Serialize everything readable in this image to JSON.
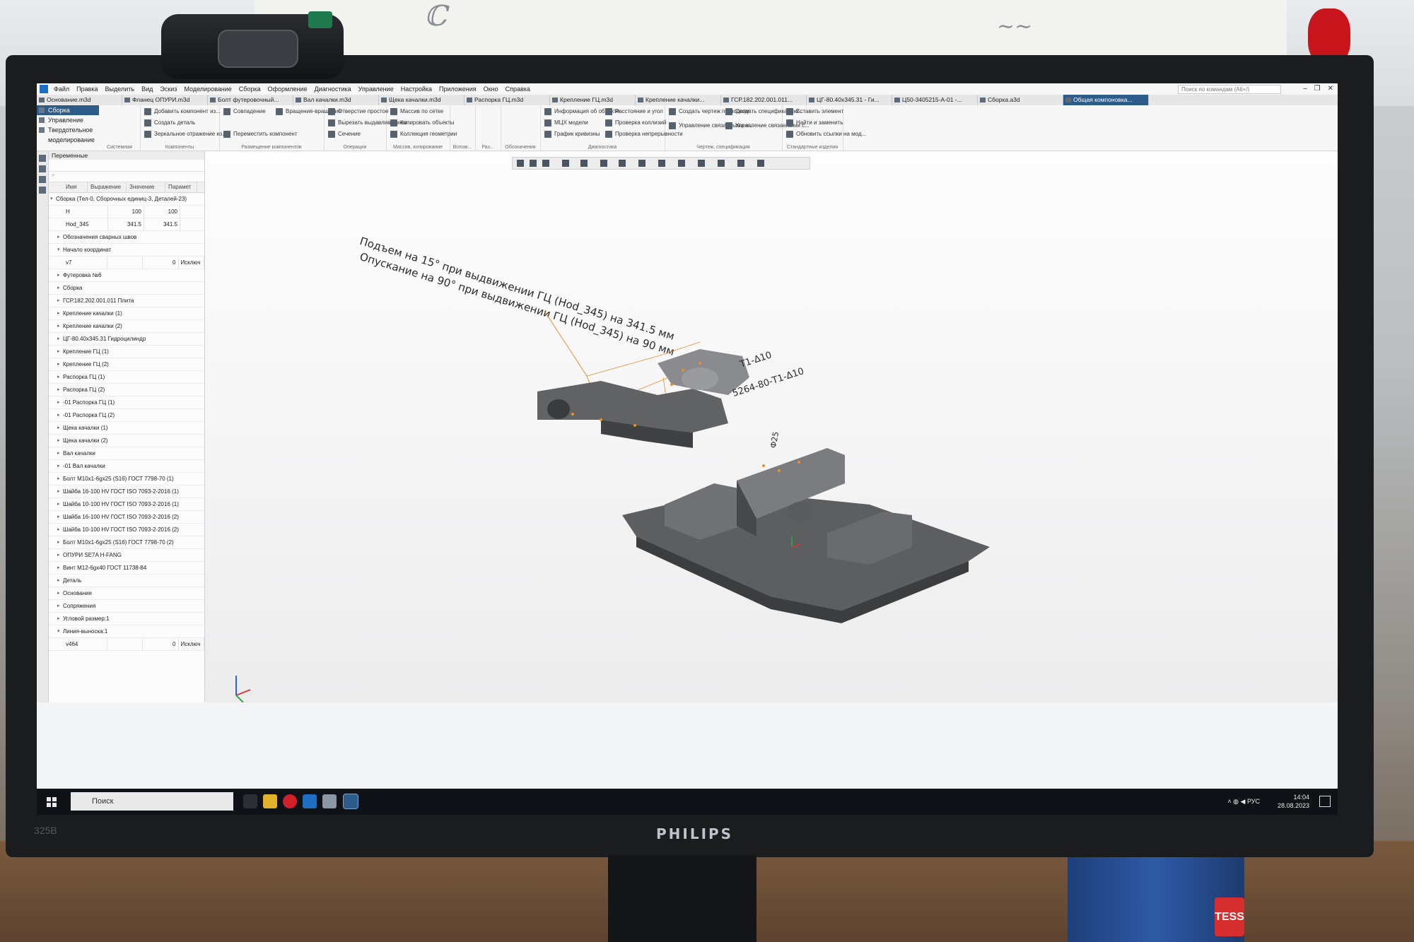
{
  "menu": {
    "items": [
      "Файл",
      "Правка",
      "Выделить",
      "Вид",
      "Эскиз",
      "Моделирование",
      "Сборка",
      "Оформление",
      "Диагностика",
      "Управление",
      "Настройка",
      "Приложения",
      "Окно",
      "Справка"
    ],
    "search_placeholder": "Поиск по командам (Alt+/)"
  },
  "tabs": [
    "Основание.m3d",
    "Фланец ОПУРИ.m3d",
    "Болт футеровочный...",
    "Вал качалки.m3d",
    "Щека качалки.m3d",
    "Распорка ГЦ.m3d",
    "Крепление ГЦ.m3d",
    "Крепление качалки...",
    "ГСР.182.202.001.011...",
    "ЦГ-80.40х345.31 - Ги...",
    "Ц50-3405215-А-01 -...",
    "Сборка.a3d",
    "Общая компоновка..."
  ],
  "ribbon": {
    "modes": [
      "Сборка",
      "Управление",
      "Твердотельное моделирование"
    ],
    "groups": [
      {
        "label": "Системная"
      },
      {
        "label": "Компоненты",
        "buttons": [
          "Добавить компонент из...",
          "Создать деталь",
          "Зеркальное отражение ко..."
        ]
      },
      {
        "label": "Размещение компонентов",
        "buttons": [
          "Совпадение",
          "Вращение-вращение",
          "Переместить компонент"
        ]
      },
      {
        "label": "Операции",
        "buttons": [
          "Отверстие простое",
          "Вырезать выдавливанием",
          "Сечение"
        ]
      },
      {
        "label": "Массив, копирование",
        "buttons": [
          "Массив по сетке",
          "Копировать объекты",
          "Коллекция геометрии"
        ]
      },
      {
        "label": "Вспом...",
        "buttons": []
      },
      {
        "label": "Раз...",
        "buttons": []
      },
      {
        "label": "Обозначения",
        "buttons": []
      },
      {
        "label": "Диагностика",
        "buttons": [
          "Информация об объекте",
          "МЦХ модели",
          "График кривизны",
          "Расстояние и угол",
          "Проверка коллизий",
          "Проверка непрерывности"
        ]
      },
      {
        "label": "Чертеж, спецификация",
        "buttons": [
          "Создать чертеж по модели",
          "Управление связанными ч...",
          "Создать спецификацию...",
          "Управление связанными с..."
        ]
      },
      {
        "label": "Стандартные изделия",
        "buttons": [
          "Вставить элемент",
          "Найти и заменить",
          "Обновить ссылки на мод..."
        ]
      }
    ]
  },
  "panel": {
    "title": "Переменные",
    "columns": [
      "Имя",
      "Выражение",
      "Значение",
      "Парамет"
    ],
    "root": "Сборка (Тел-0, Сборочных единиц-3, Деталей-23)",
    "vars": [
      {
        "name": "H",
        "expr": "100",
        "value": "100"
      },
      {
        "name": "Hod_345",
        "expr": "341.5",
        "value": "341.5"
      }
    ],
    "items1": [
      "Обозначения сварных швов",
      "Начало координат"
    ],
    "v7": {
      "name": "v7",
      "value": "0",
      "param": "Исключ"
    },
    "items2": [
      "Футеровка №6",
      "Сборка",
      "ГСР.182.202.001.011 Плита",
      "Крепление качалки (1)",
      "Крепление качалки (2)",
      "ЦГ-80.40х345.31 Гидроцилиндр",
      "Крепление ГЦ (1)",
      "Крепление ГЦ (2)",
      "Распорка ГЦ (1)",
      "Распорка ГЦ (2)",
      "-01 Распорка ГЦ (1)",
      "-01 Распорка ГЦ (2)",
      "Щека качалки (1)",
      "Щека качалки (2)",
      "Вал качалки",
      "-01 Вал качалки",
      "Болт М10х1-6gх25 (S16) ГОСТ 7798-70 (1)",
      "Шайба 16-100 HV ГОСТ ISO 7093-2-2016 (1)",
      "Шайба 10-100 HV ГОСТ ISO 7093-2-2016 (1)",
      "Шайба 16-100 HV ГОСТ ISO 7093-2-2016 (2)",
      "Шайба 10-100 HV ГОСТ ISO 7093-2-2016 (2)",
      "Болт М10х1-6gх25 (S16) ГОСТ 7798-70 (2)",
      "ОПУРИ SE7A H-FANG",
      "Винт М12-6gх40 ГОСТ 11738-84",
      "Деталь",
      "Основание",
      "Сопряжения",
      "Угловой размер:1",
      "Линия-выноска:1"
    ],
    "v464": {
      "name": "v464",
      "value": "0",
      "param": "Исключ"
    }
  },
  "viewport": {
    "note_line1": "Подъем на 15° при выдвижении ГЦ (Hod_345) на 341.5 мм",
    "note_line2": "Опускание на 90° при выдвижении ГЦ (Hod_345) на 90 мм",
    "dim1": "Т1-Δ10",
    "dim2": "5264-80-Т1-Δ10",
    "dim3": "Ф25"
  },
  "taskbar": {
    "search": "Поиск",
    "lang": "РУС",
    "time": "14:04",
    "date": "28.08.2023"
  },
  "monitor": {
    "brand": "PHILIPS",
    "model": "325B"
  },
  "colors": {
    "accent": "#2d5b8a",
    "model_gray": "#6e6f71",
    "annotation": "#e8902a"
  }
}
